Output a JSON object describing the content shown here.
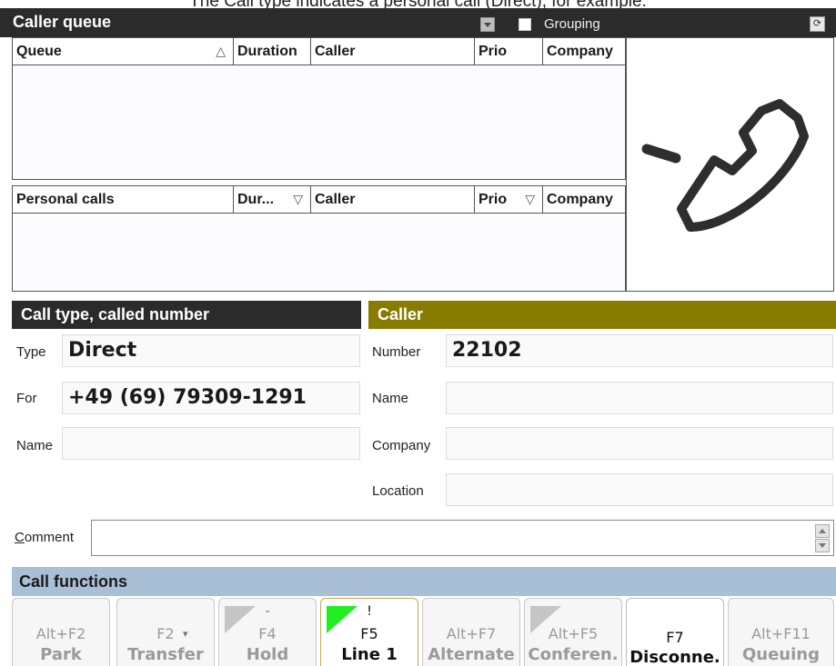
{
  "top_caption": "The Call type indicates a personal call (Direct), for example.",
  "caller_queue": {
    "title": "Caller queue",
    "grouping_label": "Grouping",
    "queue_list": {
      "columns": [
        "Queue",
        "Duration",
        "Caller",
        "Prio",
        "Company"
      ],
      "sort_indicator": "△"
    },
    "personal_list": {
      "columns": [
        "Personal calls",
        "Dur...",
        "Caller",
        "Prio",
        "Company"
      ],
      "sort_indicator": "▽"
    }
  },
  "call_type": {
    "title": "Call type, called number",
    "type_label": "Type",
    "type_value": "Direct",
    "for_label": "For",
    "for_value": "+49 (69) 79309-1291",
    "name_label": "Name",
    "name_value": ""
  },
  "caller": {
    "title": "Caller",
    "number_label": "Number",
    "number_value": "22102",
    "name_label": "Name",
    "name_value": "",
    "company_label": "Company",
    "company_value": "",
    "location_label": "Location",
    "location_value": ""
  },
  "comment": {
    "label_first": "C",
    "label_rest": "omment",
    "value": ""
  },
  "call_functions": {
    "title": "Call functions",
    "keys": [
      {
        "key": "Alt+F2",
        "name": "Park",
        "mark": ""
      },
      {
        "key": "F2",
        "name": "Transfer",
        "mark": ""
      },
      {
        "key": "F4",
        "name": "Hold",
        "mark": "-"
      },
      {
        "key": "F5",
        "name": "Line 1",
        "mark": "!"
      },
      {
        "key": "Alt+F7",
        "name": "Alternate",
        "mark": ""
      },
      {
        "key": "Alt+F5",
        "name": "Conferen.",
        "mark": ""
      },
      {
        "key": "F7",
        "name": "Disconne.",
        "mark": ""
      },
      {
        "key": "Alt+F11",
        "name": "Queuing",
        "mark": ""
      }
    ]
  },
  "colors": {
    "queue_header": "#2b2b2b",
    "caller_header": "#877c00",
    "call_functions_header": "#a9bfd6",
    "active_key_marker": "#22ee22"
  },
  "icons": {
    "phone": "phone-handset-icon",
    "settings": "settings-icon"
  }
}
